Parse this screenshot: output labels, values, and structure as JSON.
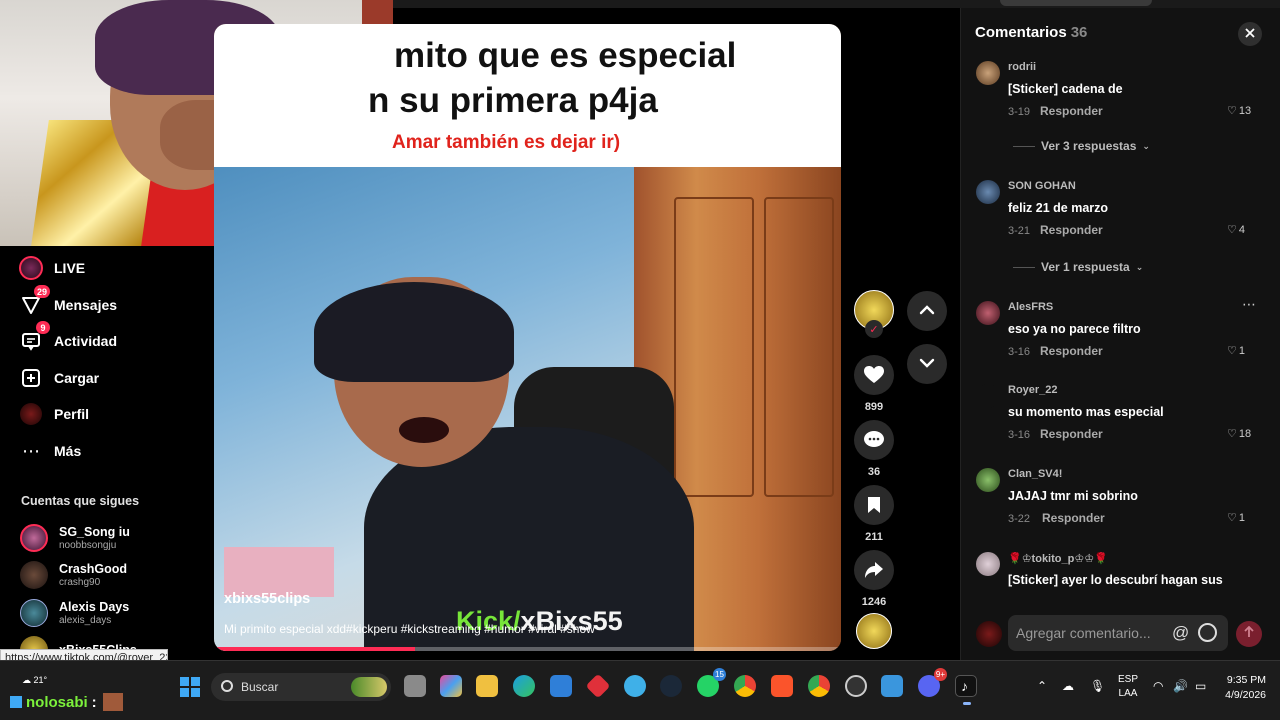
{
  "sidebar": {
    "nav": [
      {
        "label": "LIVE",
        "icon": "live-avatar-icon",
        "badge": ""
      },
      {
        "label": "Mensajes",
        "icon": "messages-icon",
        "badge": "29"
      },
      {
        "label": "Actividad",
        "icon": "activity-icon",
        "badge": "9"
      },
      {
        "label": "Cargar",
        "icon": "upload-icon",
        "badge": ""
      },
      {
        "label": "Perfil",
        "icon": "profile-avatar-icon",
        "badge": ""
      },
      {
        "label": "Más",
        "icon": "more-icon",
        "badge": ""
      }
    ],
    "following_title": "Cuentas que sigues",
    "following": [
      {
        "name": "SG_Song iu",
        "username": "noobbsongju"
      },
      {
        "name": "CrashGood",
        "username": "crashg90"
      },
      {
        "name": "Alexis Days",
        "username": "alexis_days"
      },
      {
        "name": "xBixs55Clips",
        "username": ""
      }
    ]
  },
  "status_url": "https://www.tiktok.com/@royer_22_0",
  "video": {
    "overlay_line1": "mito que es especial",
    "overlay_line2": "n su primera p4ja",
    "overlay_line3": "Amar también es dejar ir)",
    "watermark_prefix": "Kick/",
    "watermark_name": "xBixs55",
    "author": "xbixs55clips",
    "description": "Mi primito especial xdd#kickperu #kickstreaming #humor #viral #show",
    "progress": 0.32
  },
  "actions": {
    "likes": "899",
    "comments": "36",
    "saves": "211",
    "shares": "1246"
  },
  "comments_panel": {
    "title": "Comentarios",
    "count": "36",
    "comments": [
      {
        "user": "rodrii",
        "text": "[Sticker] cadena de",
        "date": "3-19",
        "reply": "Responder",
        "likes": "13",
        "view_replies": "Ver 3 respuestas"
      },
      {
        "user": "SON GOHAN",
        "text": "feliz 21 de marzo",
        "date": "3-21",
        "reply": "Responder",
        "likes": "4",
        "view_replies": "Ver 1 respuesta"
      },
      {
        "user": "AlesFRS",
        "text": "eso ya no parece filtro",
        "date": "3-16",
        "reply": "Responder",
        "likes": "1",
        "view_replies": ""
      },
      {
        "user": "Royer_22",
        "text": "su momento mas especial",
        "date": "3-16",
        "reply": "Responder",
        "likes": "18",
        "view_replies": ""
      },
      {
        "user": "Clan_SV4!",
        "text": "JAJAJ tmr mi sobrino",
        "date": "3-22",
        "reply": "Responder",
        "likes": "1",
        "view_replies": ""
      },
      {
        "user": "🌹♔tokito_p♔♔🌹",
        "text": "[Sticker] ayer lo descubrí hagan sus",
        "date": "",
        "reply": "",
        "likes": "",
        "view_replies": ""
      }
    ],
    "input_placeholder": "Agregar comentario..."
  },
  "taskbar": {
    "weather": "21°",
    "user_prefix": "nolosabi",
    "user_suffix": ":",
    "search_label": "Buscar",
    "whatsapp_badge": "15",
    "discord_badge": "9+",
    "lang_line1": "ESP",
    "lang_line2": "LAA",
    "time": "9:35 PM",
    "date": "4/9/2026"
  },
  "colors": {
    "accent": "#fe2c55",
    "background": "#000000",
    "panel": "#121212",
    "watermark": "#7cf13b"
  }
}
